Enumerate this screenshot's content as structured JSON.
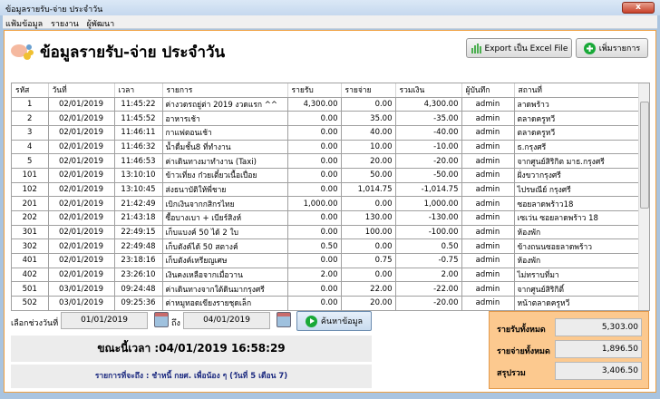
{
  "window": {
    "title": "ข้อมูลรายรับ-จ่าย ประจำวัน",
    "close": "x"
  },
  "menu": [
    "แฟ้มข้อมูล",
    "รายงาน",
    "ผู้พัฒนา"
  ],
  "header": {
    "title": "ข้อมูลรายรับ-จ่าย ประจำวัน",
    "export_label": "Export เป็น Excel File",
    "add_label": "เพิ่มรายการ"
  },
  "table": {
    "columns": [
      "รหัส",
      "วันที่",
      "เวลา",
      "รายการ",
      "รายรับ",
      "รายจ่าย",
      "รวมเงิน",
      "ผู้บันทึก",
      "สถานที่"
    ],
    "rows": [
      [
        "1",
        "02/01/2019",
        "11:45:22",
        "ค่างวดรถยู่ต่า 2019 งวดแรก ^^",
        "4,300.00",
        "0.00",
        "4,300.00",
        "admin",
        "ลาดพร้าว"
      ],
      [
        "2",
        "02/01/2019",
        "11:45:52",
        "อาหารเช้า",
        "0.00",
        "35.00",
        "-35.00",
        "admin",
        "ตลาดครูหวี"
      ],
      [
        "3",
        "02/01/2019",
        "11:46:11",
        "กาแฟตอนเช้า",
        "0.00",
        "40.00",
        "-40.00",
        "admin",
        "ตลาดครูหวี"
      ],
      [
        "4",
        "02/01/2019",
        "11:46:32",
        "น้ำดื่มชั้น8 ที่ทำงาน",
        "0.00",
        "10.00",
        "-10.00",
        "admin",
        "ธ.กรุงศรี"
      ],
      [
        "5",
        "02/01/2019",
        "11:46:53",
        "ค่าเดินทางมาทำงาน (Taxi)",
        "0.00",
        "20.00",
        "-20.00",
        "admin",
        "จากศูนย์สิริกิต มาธ.กรุงศรี"
      ],
      [
        "101",
        "02/01/2019",
        "13:10:10",
        "ข้าวเที่ยง ก๋วยเตี๋ยวเนื้อเปื่อย",
        "0.00",
        "50.00",
        "-50.00",
        "admin",
        "ฝั่งขวากรุงศรี"
      ],
      [
        "102",
        "02/01/2019",
        "13:10:45",
        "ส่งธนาบัติให้พี่ชาย",
        "0.00",
        "1,014.75",
        "-1,014.75",
        "admin",
        "ไปรษณีย์ กรุงศรี"
      ],
      [
        "201",
        "02/01/2019",
        "21:42:49",
        "เบิกเงินจากกสิกรไทย",
        "1,000.00",
        "0.00",
        "1,000.00",
        "admin",
        "ซอยลาดพร้าว18"
      ],
      [
        "202",
        "02/01/2019",
        "21:43:18",
        "ซื้อบางเบา + เบียร์สิงห์",
        "0.00",
        "130.00",
        "-130.00",
        "admin",
        "เซเว่น ซอยลาดพร้าว 18"
      ],
      [
        "301",
        "02/01/2019",
        "22:49:15",
        "เก็บแบงค์ 50 ได้ 2 ใบ",
        "0.00",
        "100.00",
        "-100.00",
        "admin",
        "ห้องพัก"
      ],
      [
        "302",
        "02/01/2019",
        "22:49:48",
        "เก็บตังค์ได้ 50 สตางค์",
        "0.50",
        "0.00",
        "0.50",
        "admin",
        "ข้างถนนซอยลาดพร้าว"
      ],
      [
        "401",
        "02/01/2019",
        "23:18:16",
        "เก็บตังค์เหรียญเศษ",
        "0.00",
        "0.75",
        "-0.75",
        "admin",
        "ห้องพัก"
      ],
      [
        "402",
        "02/01/2019",
        "23:26:10",
        "เงินคงเหลือจากเมื่อวาน",
        "2.00",
        "0.00",
        "2.00",
        "admin",
        "ไม่ทราบที่มา"
      ],
      [
        "501",
        "03/01/2019",
        "09:24:48",
        "ค่าเดินทางจากใต้ดินมากรุงศรี",
        "0.00",
        "22.00",
        "-22.00",
        "admin",
        "จากศูนย์สิริกิติ์"
      ],
      [
        "502",
        "03/01/2019",
        "09:25:36",
        "ค่าหมูทอดเขียงรายชุดเล็ก",
        "0.00",
        "20.00",
        "-20.00",
        "admin",
        "หน้าตลาดครูหวี"
      ]
    ]
  },
  "filter": {
    "label": "เลือกช่วงวันที่",
    "from": "01/01/2019",
    "to_label": "ถึง",
    "to": "04/01/2019",
    "search_label": "ค้นหาข้อมูล"
  },
  "clock": "ขณะนี้เวลา :04/01/2019 16:58:29",
  "notice": "รายการที่จะถึง : ชำหนี้ กยศ. เพื่อน้อง ๆ (วันที่ 5 เดือน 7)",
  "summary": {
    "income_label": "รายรับทั้งหมด",
    "income": "5,303.00",
    "expense_label": "รายจ่ายทั้งหมด",
    "expense": "1,896.50",
    "total_label": "สรุปรวม",
    "total": "3,406.50"
  }
}
